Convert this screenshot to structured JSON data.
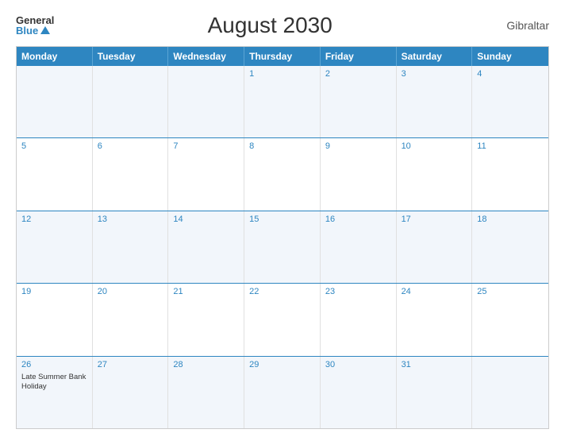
{
  "header": {
    "title": "August 2030",
    "region": "Gibraltar",
    "logo_general": "General",
    "logo_blue": "Blue"
  },
  "days_of_week": [
    "Monday",
    "Tuesday",
    "Wednesday",
    "Thursday",
    "Friday",
    "Saturday",
    "Sunday"
  ],
  "weeks": [
    [
      {
        "day": "",
        "event": ""
      },
      {
        "day": "",
        "event": ""
      },
      {
        "day": "",
        "event": ""
      },
      {
        "day": "1",
        "event": ""
      },
      {
        "day": "2",
        "event": ""
      },
      {
        "day": "3",
        "event": ""
      },
      {
        "day": "4",
        "event": ""
      }
    ],
    [
      {
        "day": "5",
        "event": ""
      },
      {
        "day": "6",
        "event": ""
      },
      {
        "day": "7",
        "event": ""
      },
      {
        "day": "8",
        "event": ""
      },
      {
        "day": "9",
        "event": ""
      },
      {
        "day": "10",
        "event": ""
      },
      {
        "day": "11",
        "event": ""
      }
    ],
    [
      {
        "day": "12",
        "event": ""
      },
      {
        "day": "13",
        "event": ""
      },
      {
        "day": "14",
        "event": ""
      },
      {
        "day": "15",
        "event": ""
      },
      {
        "day": "16",
        "event": ""
      },
      {
        "day": "17",
        "event": ""
      },
      {
        "day": "18",
        "event": ""
      }
    ],
    [
      {
        "day": "19",
        "event": ""
      },
      {
        "day": "20",
        "event": ""
      },
      {
        "day": "21",
        "event": ""
      },
      {
        "day": "22",
        "event": ""
      },
      {
        "day": "23",
        "event": ""
      },
      {
        "day": "24",
        "event": ""
      },
      {
        "day": "25",
        "event": ""
      }
    ],
    [
      {
        "day": "26",
        "event": "Late Summer Bank Holiday"
      },
      {
        "day": "27",
        "event": ""
      },
      {
        "day": "28",
        "event": ""
      },
      {
        "day": "29",
        "event": ""
      },
      {
        "day": "30",
        "event": ""
      },
      {
        "day": "31",
        "event": ""
      },
      {
        "day": "",
        "event": ""
      }
    ]
  ]
}
